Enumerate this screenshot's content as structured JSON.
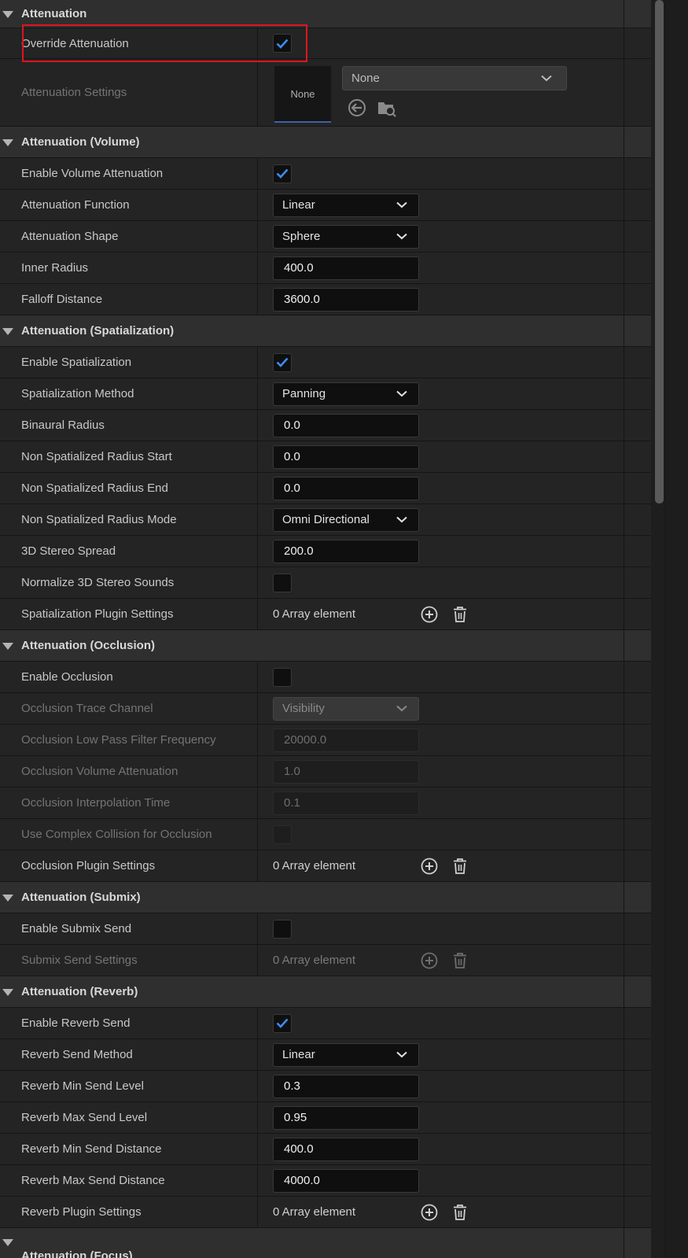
{
  "categories": {
    "attenuation": "Attenuation",
    "volume": "Attenuation (Volume)",
    "spatialization": "Attenuation (Spatialization)",
    "occlusion": "Attenuation (Occlusion)",
    "submix": "Attenuation (Submix)",
    "reverb": "Attenuation (Reverb)",
    "focus": "Attenuation (Focus)"
  },
  "attenuation": {
    "override_label": "Override Attenuation",
    "override_checked": true,
    "settings_label": "Attenuation Settings",
    "thumbnail_text": "None",
    "asset_value": "None"
  },
  "volume": {
    "enable_label": "Enable Volume Attenuation",
    "enable_checked": true,
    "function_label": "Attenuation Function",
    "function_value": "Linear",
    "shape_label": "Attenuation Shape",
    "shape_value": "Sphere",
    "inner_radius_label": "Inner Radius",
    "inner_radius_value": "400.0",
    "falloff_label": "Falloff Distance",
    "falloff_value": "3600.0"
  },
  "spatialization": {
    "enable_label": "Enable Spatialization",
    "enable_checked": true,
    "method_label": "Spatialization Method",
    "method_value": "Panning",
    "binaural_label": "Binaural Radius",
    "binaural_value": "0.0",
    "ns_start_label": "Non Spatialized Radius Start",
    "ns_start_value": "0.0",
    "ns_end_label": "Non Spatialized Radius End",
    "ns_end_value": "0.0",
    "ns_mode_label": "Non Spatialized Radius Mode",
    "ns_mode_value": "Omni Directional",
    "stereo_spread_label": "3D Stereo Spread",
    "stereo_spread_value": "200.0",
    "normalize_label": "Normalize 3D Stereo Sounds",
    "normalize_checked": false,
    "plugin_label": "Spatialization Plugin Settings",
    "plugin_value": "0 Array element"
  },
  "occlusion": {
    "enable_label": "Enable Occlusion",
    "enable_checked": false,
    "trace_label": "Occlusion Trace Channel",
    "trace_value": "Visibility",
    "lowpass_label": "Occlusion Low Pass Filter Frequency",
    "lowpass_value": "20000.0",
    "volume_label": "Occlusion Volume Attenuation",
    "volume_value": "1.0",
    "interp_label": "Occlusion Interpolation Time",
    "interp_value": "0.1",
    "complex_label": "Use Complex Collision for Occlusion",
    "complex_checked": false,
    "plugin_label": "Occlusion Plugin Settings",
    "plugin_value": "0 Array element"
  },
  "submix": {
    "enable_label": "Enable Submix Send",
    "enable_checked": false,
    "settings_label": "Submix Send Settings",
    "settings_value": "0 Array element"
  },
  "reverb": {
    "enable_label": "Enable Reverb Send",
    "enable_checked": true,
    "method_label": "Reverb Send Method",
    "method_value": "Linear",
    "min_level_label": "Reverb Min Send Level",
    "min_level_value": "0.3",
    "max_level_label": "Reverb Max Send Level",
    "max_level_value": "0.95",
    "min_dist_label": "Reverb Min Send Distance",
    "min_dist_value": "400.0",
    "max_dist_label": "Reverb Max Send Distance",
    "max_dist_value": "4000.0",
    "plugin_label": "Reverb Plugin Settings",
    "plugin_value": "0 Array element"
  },
  "colors": {
    "checkmark": "#3b8cf0",
    "highlight": "#e0141e"
  }
}
